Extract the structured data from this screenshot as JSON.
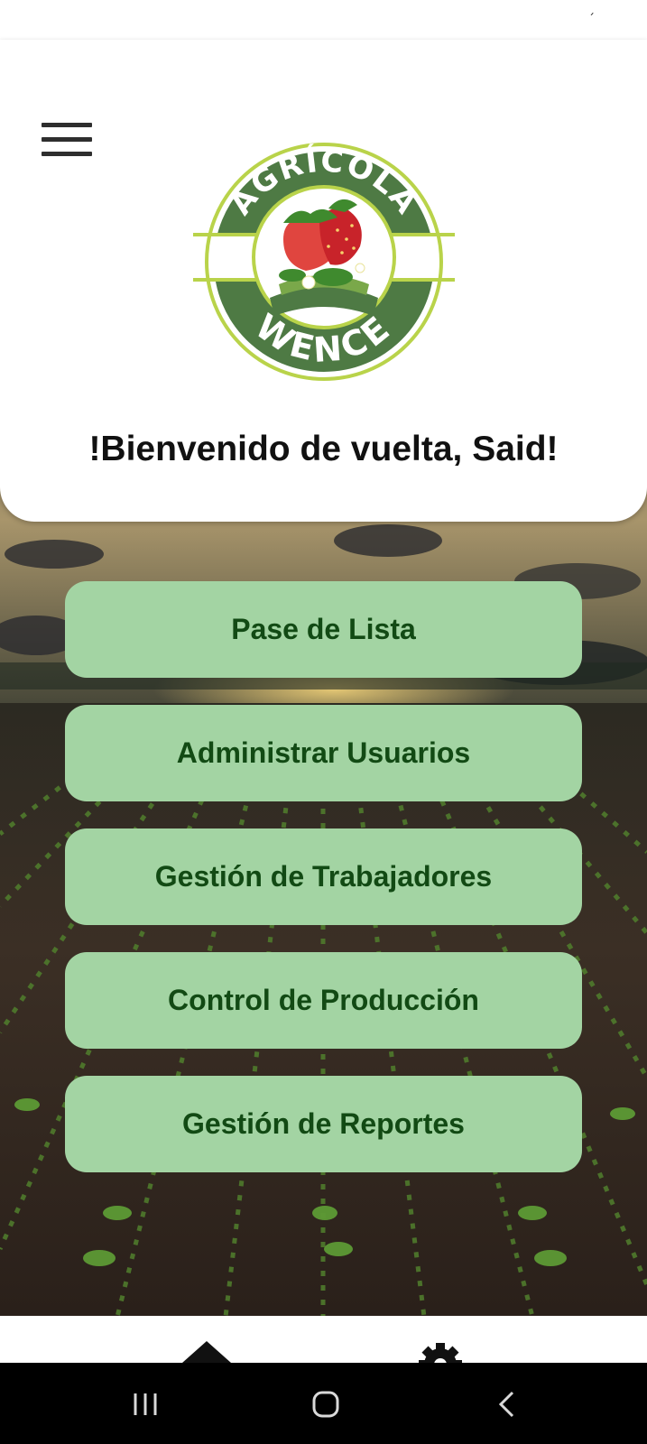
{
  "status_bar": {
    "glyph": "´"
  },
  "header": {
    "menu_icon": "hamburger-menu-icon",
    "logo": {
      "top_text": "AGRÍCOLA",
      "bottom_text": "WENCE"
    },
    "welcome": "!Bienvenido de vuelta, Said!"
  },
  "menu": {
    "items": [
      {
        "label": "Pase de Lista"
      },
      {
        "label": "Administrar Usuarios"
      },
      {
        "label": "Gestión de Trabajadores"
      },
      {
        "label": "Control de Producción"
      },
      {
        "label": "Gestión de Reportes"
      }
    ]
  },
  "bottom_nav": {
    "items": [
      "home-indicator-icon",
      "settings-gear-icon"
    ]
  },
  "system_nav": {
    "items": [
      "recent-apps-icon",
      "home-icon",
      "back-icon"
    ]
  },
  "colors": {
    "button_bg": "#a3d4a3",
    "button_text": "#124a14",
    "logo_dark_green": "#4e7a44",
    "logo_light_green": "#b9d34a"
  }
}
